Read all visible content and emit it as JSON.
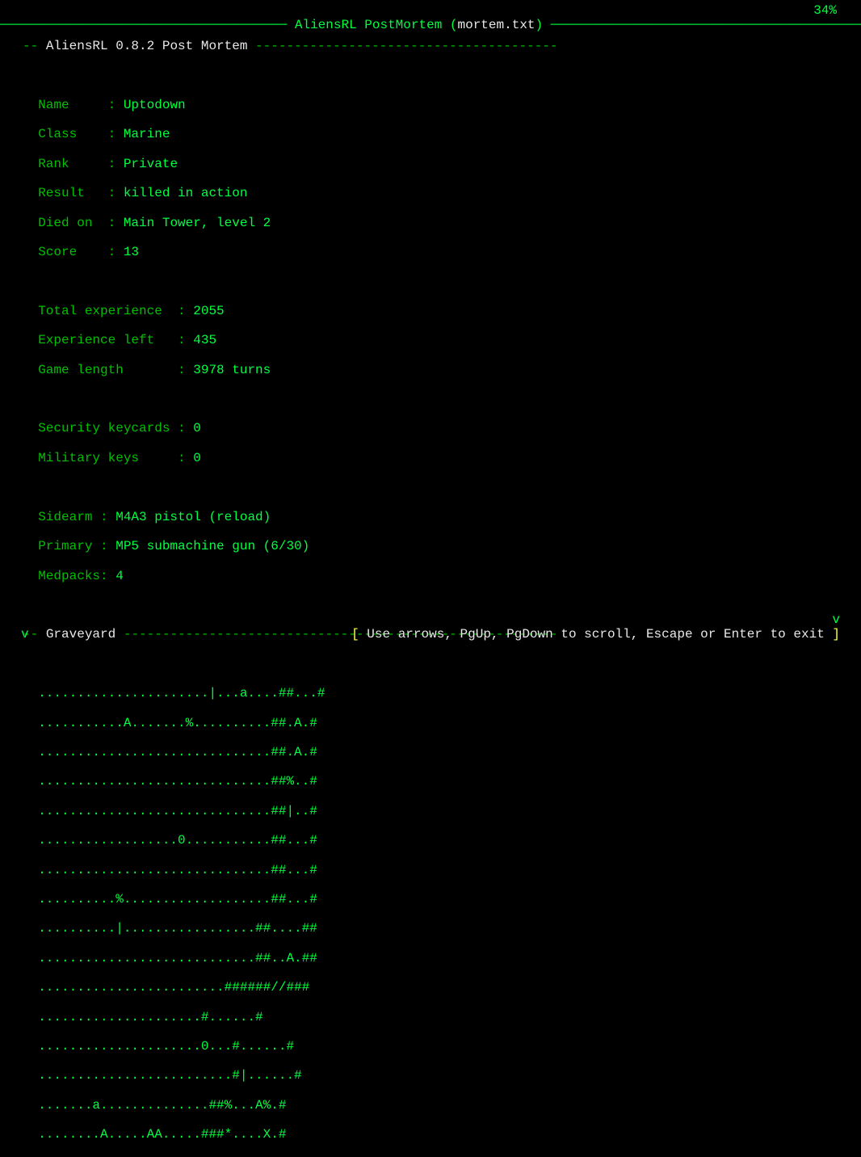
{
  "titlebar": {
    "dash_left": "───────────────────────────────────── ",
    "game": "AliensRL PostMortem",
    "lp": " (",
    "file": "mortem.txt",
    "rp": ")",
    "dash_right": " ─────────────────────────────────────────────",
    "percent": "34%"
  },
  "header": {
    "prefix": "-- ",
    "title": "AliensRL 0.8.2 Post Mortem",
    "dash": " ---------------------------------------"
  },
  "stats": [
    {
      "label": "  Name     : ",
      "value": "Uptodown"
    },
    {
      "label": "  Class    : ",
      "value": "Marine"
    },
    {
      "label": "  Rank     : ",
      "value": "Private"
    },
    {
      "label": "  Result   : ",
      "value": "killed in action"
    },
    {
      "label": "  Died on  : ",
      "value": "Main Tower, level 2"
    },
    {
      "label": "  Score    : ",
      "value": "13"
    }
  ],
  "more": [
    {
      "label": "  Total experience  : ",
      "value": "2055"
    },
    {
      "label": "  Experience left   : ",
      "value": "435"
    },
    {
      "label": "  Game length       : ",
      "value": "3978 turns"
    }
  ],
  "keys": [
    {
      "label": "  Security keycards : ",
      "value": "0"
    },
    {
      "label": "  Military keys     : ",
      "value": "0"
    }
  ],
  "loadout": [
    {
      "label": "  Sidearm : ",
      "value": "M4A3 pistol (reload)"
    },
    {
      "label": "  Primary : ",
      "value": "MP5 submachine gun (6/30)"
    },
    {
      "label": "  Medpacks: ",
      "value": "4"
    }
  ],
  "graveyard_header": {
    "prefix": "-- ",
    "title": "Graveyard",
    "dash": " --------------------------------------------------------"
  },
  "map": [
    "  ......................|...a....##...#",
    "  ...........A.......%..........##.A.#",
    "  ..............................##.A.#",
    "  ..............................##%..#",
    "  ..............................##|..#",
    "  ..................0...........##...#",
    "  ..............................##...#",
    "  ..........%...................##...#",
    "  ..........|.................##....##",
    "  ............................##..A.##",
    "  ........................######//###",
    "  .....................#......#",
    "  .....................0...#......#",
    "  .........................#|......#",
    "  .......a..............##%...A%.#",
    "  ........A.....AA.....###*....X.#"
  ],
  "footer": {
    "arrow_l": "v",
    "arrow_r": "v",
    "lb": "[ ",
    "text": "Use arrows, PgUp, PgDown to scroll, Escape or Enter to exit",
    "rb": " ]"
  }
}
